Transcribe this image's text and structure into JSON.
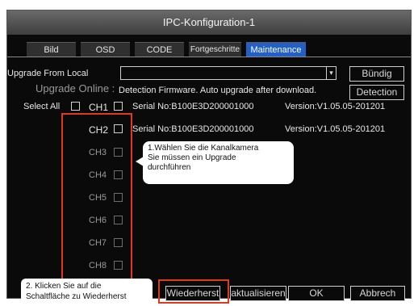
{
  "window": {
    "title": "IPC-Konfiguration-1"
  },
  "tabs": [
    "Bild",
    "OSD",
    "CODE",
    "Fortgeschritte",
    "Maintenance"
  ],
  "upgrade_local": {
    "label": "Upgrade From Local",
    "value": "",
    "dropdown_arrow": "▾",
    "button": "Bündig"
  },
  "upgrade_online": {
    "label": "Upgrade Online :",
    "description": "Detection Firmware. Auto upgrade after download.",
    "button": "Detection"
  },
  "select_all_label": "Select All",
  "channels": [
    {
      "label": "CH1",
      "serial": "Serial No:B100E3D200001000",
      "version": "Version:V1.05.05-201201",
      "enabled": true
    },
    {
      "label": "CH2",
      "serial": "Serial No:B100E3D200001000",
      "version": "Version:V1.05.05-201201",
      "enabled": true
    },
    {
      "label": "CH3",
      "enabled": false
    },
    {
      "label": "CH4",
      "enabled": false
    },
    {
      "label": "CH5",
      "enabled": false
    },
    {
      "label": "CH6",
      "enabled": false
    },
    {
      "label": "CH7",
      "enabled": false
    },
    {
      "label": "CH8",
      "enabled": false
    }
  ],
  "annotations": {
    "step1": [
      "1.Wählen Sie die Kanalkamera",
      "Sie müssen ein Upgrade",
      "durchführen"
    ],
    "step2": [
      "2. Klicken Sie auf die",
      "Schaltfläche zu Wiederherst"
    ]
  },
  "footer_buttons": {
    "restore": "Wiederherst",
    "refresh": "aktualisieren",
    "ok": "OK",
    "cancel": "Abbrech"
  },
  "colors": {
    "highlight": "#e03a1e",
    "active_tab": "#2260c8"
  }
}
